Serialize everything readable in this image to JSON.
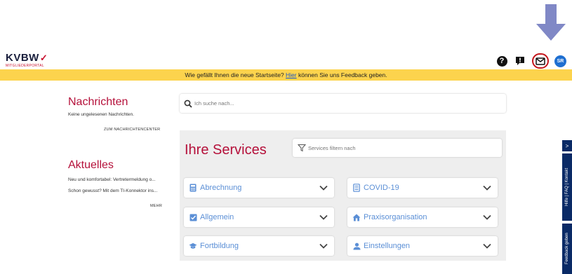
{
  "logo": {
    "name": "KVBW",
    "sub": "MITGLIEDERPORTAL"
  },
  "header": {
    "icons": [
      "help-icon",
      "feedback-icon",
      "mail-icon",
      "avatar"
    ],
    "avatar_initials": "SR"
  },
  "banner": {
    "text_before": "Wie gefällt Ihnen die neue Startseite? ",
    "link": "Hier",
    "text_after": " können Sie uns Feedback geben."
  },
  "messages": {
    "title": "Nachrichten",
    "status": "Keine ungelesenen Nachrichten.",
    "link": "ZUM NACHRICHTENCENTER"
  },
  "news": {
    "title": "Aktuelles",
    "items": [
      "Neu und komfortabel: Vertretermeldung o...",
      "Schon gewusst? Mit dem TI-Konnektor ins..."
    ],
    "more": "MEHR"
  },
  "search": {
    "placeholder": "Ich suche nach..."
  },
  "services": {
    "title": "Ihre Services",
    "filter_placeholder": "Services filtern nach",
    "cards": [
      {
        "label": "Abrechnung",
        "icon": "calculator-icon"
      },
      {
        "label": "COVID-19",
        "icon": "document-icon"
      },
      {
        "label": "Allgemein",
        "icon": "checkbox-icon"
      },
      {
        "label": "Praxisorganisation",
        "icon": "house-icon"
      },
      {
        "label": "Fortbildung",
        "icon": "graduation-cap-icon"
      },
      {
        "label": "Einstellungen",
        "icon": "user-icon"
      }
    ]
  },
  "side_tabs": {
    "arrow": ">",
    "help": "Hilfe | FAQ | Kontakt",
    "feedback": "Feedback geben"
  },
  "colors": {
    "brand_red": "#b5103a",
    "banner_yellow": "#fcd34d",
    "link_blue": "#5b8fd6",
    "side_navy": "#0a2a66"
  }
}
